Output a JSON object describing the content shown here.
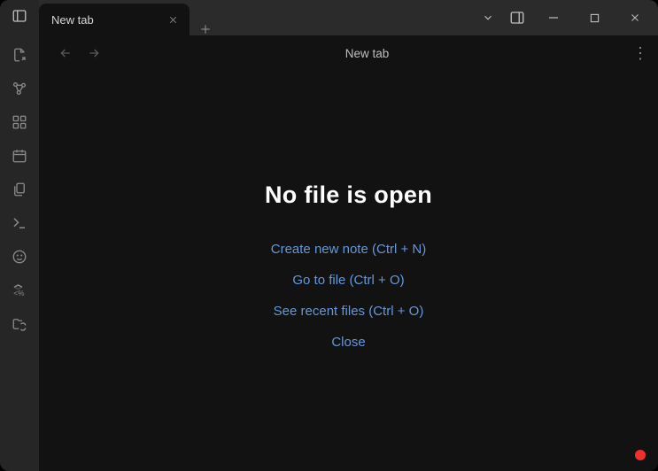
{
  "titlebar": {
    "tab_label": "New tab"
  },
  "view": {
    "header_title": "New tab"
  },
  "empty": {
    "heading": "No file is open",
    "actions": {
      "create": "Create new note (Ctrl + N)",
      "goto": "Go to file (Ctrl + O)",
      "recent": "See recent files (Ctrl + O)",
      "close": "Close"
    }
  },
  "ribbon": {
    "items": [
      {
        "name": "quick-switcher-icon"
      },
      {
        "name": "graph-view-icon"
      },
      {
        "name": "canvas-icon"
      },
      {
        "name": "daily-note-icon"
      },
      {
        "name": "files-icon"
      },
      {
        "name": "command-palette-icon"
      },
      {
        "name": "emoji-icon"
      },
      {
        "name": "templates-icon"
      },
      {
        "name": "folder-sync-icon"
      }
    ]
  }
}
